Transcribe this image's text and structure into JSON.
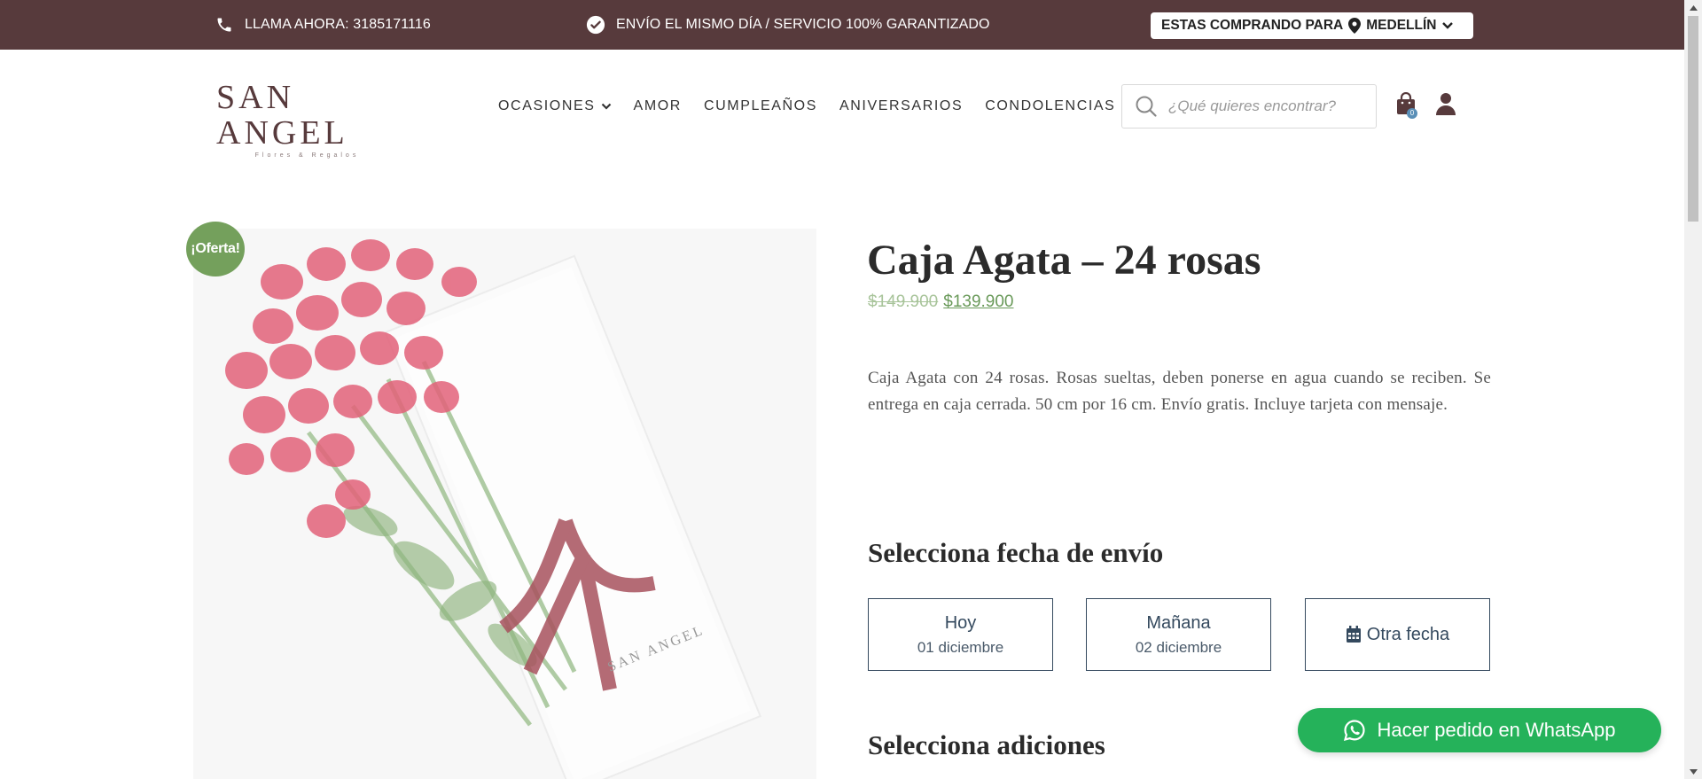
{
  "topbar": {
    "call_text": "LLAMA AHORA: 3185171116",
    "shipping_text": "ENVÍO EL MISMO DÍA / SERVICIO 100% GARANTIZADO",
    "location_prefix": "ESTAS COMPRANDO PARA",
    "location_city": "MEDELLÍN",
    "background": "#573a3c"
  },
  "header": {
    "logo_main": "SAN ANGEL",
    "logo_sub": "Flores & Regalos",
    "nav": [
      "OCASIONES",
      "AMOR",
      "CUMPLEAÑOS",
      "ANIVERSARIOS",
      "CONDOLENCIAS"
    ],
    "search_placeholder": "¿Qué quieres encontrar?",
    "cart_count": "0"
  },
  "product": {
    "badge": "¡Oferta!",
    "title": "Caja Agata – 24 rosas",
    "old_price": "$149.900",
    "new_price": "$139.900",
    "description": "Caja Agata con 24 rosas. Rosas sueltas, deben ponerse en agua cuando se reciben. Se entrega en caja cerrada. 50 cm por 16 cm. Envío gratis. Incluye tarjeta con mensaje."
  },
  "delivery": {
    "heading": "Selecciona fecha de envío",
    "options": [
      {
        "label": "Hoy",
        "date": "01 diciembre"
      },
      {
        "label": "Mañana",
        "date": "02 diciembre"
      },
      {
        "label": "Otra fecha"
      }
    ]
  },
  "additions": {
    "heading": "Selecciona adiciones"
  },
  "whatsapp": {
    "label": "Hacer pedido en WhatsApp",
    "color": "#25b25a"
  },
  "accent_colors": {
    "brand": "#573a3c",
    "price": "#6a9a5a",
    "button_border": "#34495e"
  }
}
